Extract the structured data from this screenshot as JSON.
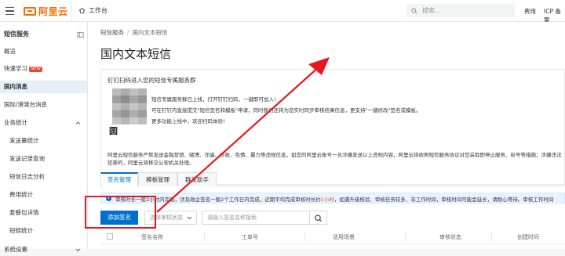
{
  "colors": {
    "brand": "#ff6a00",
    "accent": "#0070cc",
    "annotation": "#e8161f",
    "warning": "#f04134"
  },
  "topbar": {
    "logo_text": "阿里云",
    "home_label": "工作台",
    "search_placeholder": "搜索...",
    "links": [
      "费用",
      "ICP 备案"
    ]
  },
  "sidebar": {
    "title": "短信服务",
    "collapse_icon": "collapse-icon",
    "items": [
      {
        "label": "概览"
      },
      {
        "label": "快速学习",
        "badge": "NEW"
      },
      {
        "label": "国内消息",
        "active": true
      },
      {
        "label": "国际/港澳台消息"
      },
      {
        "label": "业务统计",
        "expandable": true
      },
      {
        "label": "发送量统计",
        "sub": true
      },
      {
        "label": "发送记录查询",
        "sub": true
      },
      {
        "label": "短信日志分析",
        "sub": true
      },
      {
        "label": "费用统计",
        "sub": true
      },
      {
        "label": "套餐包详情",
        "sub": true
      },
      {
        "label": "短链统计",
        "sub": true
      },
      {
        "label": "系统设置",
        "expandable": true
      }
    ]
  },
  "breadcrumb": {
    "root": "短信服务",
    "separator": "/",
    "current": "国内文本短信"
  },
  "page": {
    "title": "国内文本短信"
  },
  "notice": {
    "heading": "钉钉扫码进入您的短信专属服务群",
    "qr_caption": "圆",
    "lines": [
      "短信专属服务群已上线，打开钉钉扫码，一键即可加入!",
      "可在钉钉内直接提交\"短信签名和模板\"申请，同时我们还将为您实时同步审核结果信息，更支持\"一键修改\"签名或模板。",
      "更多功能上线中，欢迎扫码体验!"
    ],
    "description": "阿里云短信服务严禁发送金融营销、赌博、诈骗、涉政、色情、暴力等违规信息，如您的阿里云账号一旦涉嫌发送以上违规内容，阿里云将依照短信服务协议对您采取即停止服务、封号等措施；涉嫌违法犯罪的，阿里云将移交公安机关处理。"
  },
  "tabs": [
    {
      "label": "签名管理",
      "active": true
    },
    {
      "label": "模板管理"
    },
    {
      "label": "群发助手"
    }
  ],
  "info_bar": {
    "before": "审核时长一般2小时内完成，涉及政企签名一般2个工作日内完成，近期平均完成审核时长约",
    "highlight": "1小时",
    "after": "，如遇升级核验、审核任务较多、非工作时间，审核时间可能会延长，请耐心等待。审核工作时间"
  },
  "toolbar": {
    "add_button": "添加签名",
    "status_select": "选择审核状态",
    "search_placeholder": "请输入签名名称搜索"
  },
  "table": {
    "columns": [
      "签名名称",
      "工单号",
      "适用场景",
      "审核状态",
      "创建时间"
    ]
  }
}
